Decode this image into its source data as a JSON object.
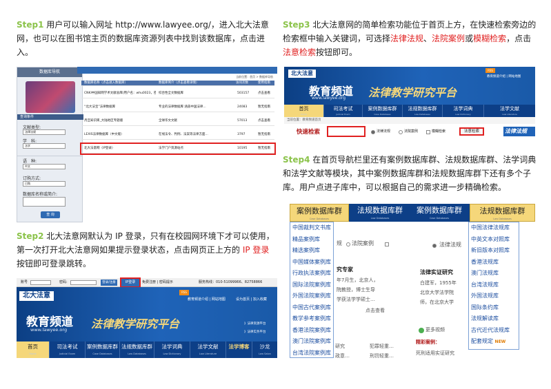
{
  "steps": {
    "s1": {
      "tag": "Step1",
      "text": " 用户可以输入网址 http://www.lawyee.org/，进入北大法意网，也可以在图书馆主页的数据库资源列表中找到该数据库，点击进入。"
    },
    "s2": {
      "tag": "Step2",
      "text_a": " 北大法意网默认为 IP 登录，只有在校园网环境下才可以使用，第一次打开北大法意网如果提示登录状态，点击网页正上方的 ",
      "ip_login": "IP 登录",
      "text_b": "按钮即可登录跳转。"
    },
    "s3": {
      "tag": "Step3",
      "text_a": " 北大法意网的简单检索功能位于首页上方，在快速检索旁边的检索框中输入关键词，可选择",
      "o1": "法律法规",
      "sep1": "、",
      "o2": "法院案例",
      "mid": "或",
      "o3": "模糊检索",
      "text_b": "，点击",
      "btn": "法意检索",
      "text_c": "按钮即可。"
    },
    "s4": {
      "tag": "Step4",
      "text": " 在首页导航栏里还有案例数据库群、法规数据库群、法学词典和法学文献等模块，其中案例数据库群和法规数据库群下还有多个子库。用户点进子库中，可以根据自己的需求进一步精确检索。"
    }
  },
  "shot1": {
    "nav_title": "数据库导航",
    "select_label": "查询条件",
    "fields": [
      {
        "label": "文献类型:",
        "value": "法律法规"
      },
      {
        "label": "学　科:",
        "value": "法学"
      },
      {
        "label": "语　种:",
        "value": "中文"
      },
      {
        "label": "订购方式:",
        "value": "已购"
      },
      {
        "label": "数据库名称或简介:",
        "value": ""
      }
    ],
    "query_btn": "查 询",
    "path": "当前位置：首页 > 数据库导航",
    "headers": [
      "数据库名称（点击进入数据库）",
      "数据库简介（点击查看详情）",
      "访问次数",
      "使用指南"
    ],
    "rows": [
      [
        "CNKI中国知网学术文献总库(用户名：whu0023，密码...",
        "综合性全文数据库",
        "503157",
        "点击查看"
      ],
      [
        "“北大法宝”法律数据库",
        "专业的法律数据库 涵盖中国法律...",
        "24083",
        "暂无指南"
      ],
      [
        "月旦知识库_大陆地区专题版",
        "全球华文文献",
        "57013",
        "点击查看"
      ],
      [
        "LEXIS法律数据库（中文版）",
        "在线法令、判例、法案等法律方面...",
        "3797",
        "暂无指南"
      ],
      [
        "北大法意网（IP登录）",
        "法学门户资源站点",
        "10195",
        "暂无指南"
      ]
    ]
  },
  "shot2": {
    "bar_user": "账号",
    "bar_pwd": "密码:",
    "login_btn": "登录/注册",
    "ip_btn": "IP登录",
    "bar_links": "免费注册 | 密码提示",
    "hotline": "服务热线：010-51099966、82758866",
    "rss": "RSS",
    "links": "教育频道介绍 | 网站地图",
    "links2": "设为首页 | 加入收藏",
    "logo": "北大法意",
    "edu": "教育频道",
    "url": "www.lawyee.org",
    "slogan": "法律教学研究平台",
    "side1": "》法律资源平台",
    "side2": "》法律实务平台",
    "menu": [
      {
        "cn": "首页",
        "en": "Home"
      },
      {
        "cn": "司法考试",
        "en": "Judicial Exam"
      },
      {
        "cn": "案例数据库群",
        "en": "Case Databases"
      },
      {
        "cn": "法规数据库群",
        "en": "Law Databases"
      },
      {
        "cn": "法学词典",
        "en": "Law Dictionary"
      },
      {
        "cn": "法学文献",
        "en": "Law Literature"
      },
      {
        "cn": "法学博客",
        "en": ""
      },
      {
        "cn": "沙龙",
        "en": "Law Salon"
      }
    ]
  },
  "shot3": {
    "logo": "北大法意",
    "rss": "RSS",
    "links": "教育频道介绍 | 网站地图",
    "edu": "教育频道",
    "url": "www.lawyee.org",
    "slogan": "法律教学研究平台",
    "menu": [
      {
        "cn": "首页",
        "en": "Home"
      },
      {
        "cn": "司法考试",
        "en": "Judicial Exam"
      },
      {
        "cn": "案例数据库群",
        "en": "Case Databases"
      },
      {
        "cn": "法规数据库群",
        "en": "Law Databases"
      },
      {
        "cn": "法学词典",
        "en": "Law Dictionary"
      },
      {
        "cn": "法学文献",
        "en": "Law Literature"
      }
    ],
    "crumb": "当前位置：教育频道首页",
    "quick": "快速检索",
    "opt1": "法律法规",
    "opt2": "法院案例",
    "opt3": "模糊检索",
    "search_btn": "法意检索",
    "right": "法律法规"
  },
  "shot4": {
    "tab_case": {
      "cn": "案例数据库群",
      "en": "Case Databases"
    },
    "tab_law": {
      "cn": "法规数据库群",
      "en": "Law Databases"
    },
    "case_list": [
      "中国裁判文书库",
      "精品案例库",
      "精选案例库",
      "中国媒体案例库",
      "行政执法案例库",
      "国际法院案例库",
      "外国法院案例库",
      "中国古代案例库",
      "教学参考案例库",
      "香港法院案例库",
      "澳门法院案例库",
      "台湾法院案例库"
    ],
    "law_list": [
      "中国法律法规库",
      "中英文本对照库",
      "新旧版本对照库",
      "香港法规库",
      "澳门法规库",
      "台湾法规库",
      "外国法规库",
      "国际条约库",
      "法规解读库",
      "古代近代法规库",
      "配套规定"
    ],
    "new_badge": "NEW",
    "bg_left": {
      "rule": "规",
      "opt": "法院案例",
      "expert": "究专家",
      "desc1": "年7月生，北京人，",
      "desc2": "院教授，博士生导",
      "desc3": "学获法学学硕士…",
      "more": "点击查看",
      "b1": "研究",
      "b2": "政意…",
      "c1": "犯罪轻重…",
      "c2": "刑罚轻重…"
    },
    "bg_right": {
      "opt": "法律法规",
      "expert": "法律实证研究",
      "desc1": "白建军，1955年",
      "desc2": "北京大学法学院",
      "desc3": "师，在北京大学",
      "video": "更多视频",
      "sample": "精彩案例：",
      "s1": "死刑适用实证研究"
    }
  }
}
